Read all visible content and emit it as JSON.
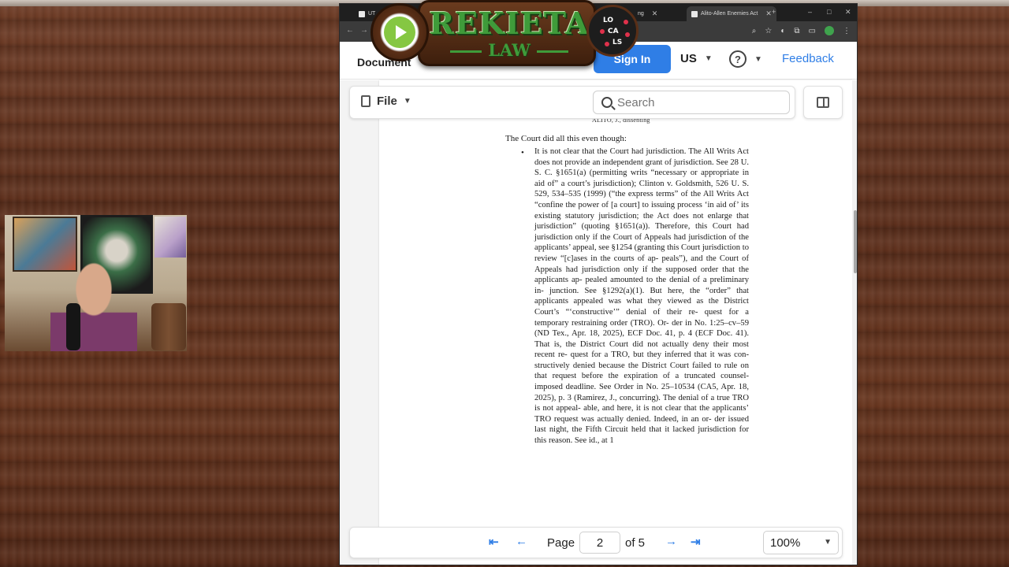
{
  "browser": {
    "tabs": [
      {
        "label": "UT",
        "active": false
      },
      {
        "label": "ng",
        "active": false
      },
      {
        "label": "Alito-Allen Enemies Act",
        "active": true
      }
    ],
    "window_controls": [
      "–",
      "□",
      "✕"
    ]
  },
  "logo": {
    "name": "REKIETA",
    "sub": "LAW",
    "locals_letters": [
      "LO",
      "CA",
      "LS"
    ]
  },
  "header": {
    "title": "Document",
    "signin_label": "Sign In",
    "language": "US",
    "help_icon": "?",
    "feedback_label": "Feedback"
  },
  "toolbar": {
    "file_label": "File",
    "search_placeholder": "Search"
  },
  "document": {
    "running_head": "ALITO, J., dissenting",
    "intro": "The Court did all this even though:",
    "bullet": "•",
    "paragraph": "It is not clear that the Court had jurisdiction. The All Writs Act does not provide an independent grant of jurisdiction. See 28 U. S. C. §1651(a) (permitting writs “necessary or appropriate in aid of” a court’s jurisdiction); Clinton v. Goldsmith, 526 U. S. 529, 534–535 (1999) (“the express terms” of the All Writs Act “confine the power of [a court] to issuing process ‘in aid of’ its existing statutory jurisdiction; the Act does not enlarge that jurisdiction” (quoting §1651(a)). Therefore, this Court had jurisdiction only if the Court of Appeals had jurisdiction of the applicants’ appeal, see §1254 (granting this Court jurisdiction to review “[c]ases in the courts of ap- peals”), and the Court of Appeals had jurisdiction only if the supposed order that the applicants ap- pealed amounted to the denial of a preliminary in- junction. See §1292(a)(1). But here, the “order” that applicants appealed was what they viewed as the District Court’s “‘constructive’” denial of their re- quest for a temporary restraining order (TRO). Or- der in No. 1:25–cv–59 (ND Tex., Apr. 18, 2025), ECF Doc. 41, p. 4 (ECF Doc. 41). That is, the District Court did not actually deny their most recent re- quest for a TRO, but they inferred that it was con- structively denied because the District Court failed to rule on that request before the expiration of a truncated counsel-imposed deadline. See Order in No. 25–10534 (CA5, Apr. 18, 2025), p. 3 (Ramirez, J., concurring). The denial of a true TRO is not appeal- able, and here, it is not clear that the applicants’ TRO request was actually denied. Indeed, in an or- der issued last night, the Fifth Circuit held that it lacked jurisdiction for this reason. See id., at 1"
  },
  "pager": {
    "first_icon": "first-page-icon",
    "prev_icon": "prev-page-icon",
    "next_icon": "next-page-icon",
    "last_icon": "last-page-icon",
    "page_label": "Page",
    "current_page": "2",
    "of_label": "of 5",
    "zoom": "100%"
  },
  "colors": {
    "accent": "#2f7ee6",
    "logo_green": "#3f9b3a",
    "wood": "#5c2f1c"
  }
}
